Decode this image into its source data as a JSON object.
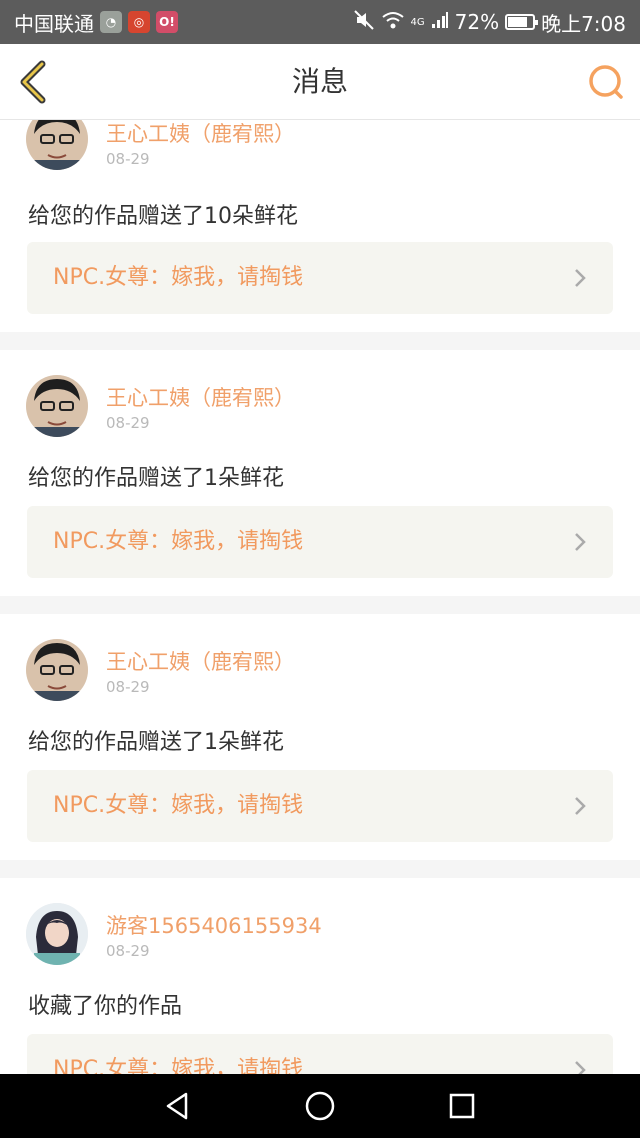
{
  "status_bar": {
    "carrier": "中国联通",
    "network": "4G",
    "battery": "72%",
    "time": "晚上7:08"
  },
  "header": {
    "title": "消息"
  },
  "messages": [
    {
      "user": "王心工姨（鹿宥熙）",
      "date": "08-29",
      "text": "给您的作品赠送了10朵鲜花",
      "work": "NPC.女尊：嫁我，请掏钱"
    },
    {
      "user": "王心工姨（鹿宥熙）",
      "date": "08-29",
      "text": "给您的作品赠送了1朵鲜花",
      "work": "NPC.女尊：嫁我，请掏钱"
    },
    {
      "user": "王心工姨（鹿宥熙）",
      "date": "08-29",
      "text": "给您的作品赠送了1朵鲜花",
      "work": "NPC.女尊：嫁我，请掏钱"
    },
    {
      "user": "游客1565406155934",
      "date": "08-29",
      "text": "收藏了你的作品",
      "work": "NPC.女尊：嫁我，请掏钱"
    }
  ]
}
